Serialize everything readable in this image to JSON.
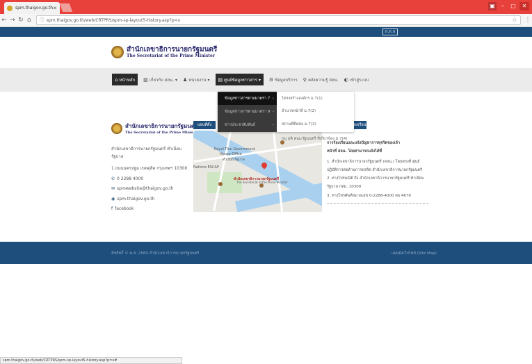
{
  "browser": {
    "tab_title": "spm.thaigov.go.th",
    "url": "spm.thaigov.go.th/web/CRTPRS/spm-sp-layout5-history.asp?p=x",
    "status_url": "spm.thaigov.go.th/web/CRTPRS/spm-sp-layout5-history.asp?p=x#"
  },
  "topstrip": {
    "badge": "ก.ก.ก"
  },
  "logo": {
    "thai": "สำนักเลขาธิการนายกรัฐมนตรี",
    "english": "The Secretariat of the Prime Minister"
  },
  "menu": [
    {
      "icon": "⌂",
      "label": "หน้าหลัก"
    },
    {
      "icon": "▥",
      "label": "เกี่ยวกับ สลน. ▾"
    },
    {
      "icon": "♟",
      "label": "หน่วยงาน ▾"
    },
    {
      "icon": "▤",
      "label": "ศูนย์ข้อมูลข่าวสาร ▾"
    },
    {
      "icon": "⚙",
      "label": "ข้อมูลบริการ"
    },
    {
      "icon": "♀",
      "label": "คลังความรู้ สลน."
    },
    {
      "icon": "◐",
      "label": "เข้าสู่ระบบ"
    }
  ],
  "dropdown": {
    "left": [
      {
        "label": "ข้อมูลข่าวสารตามมาตรา 7",
        "arrow": "›"
      },
      {
        "label": "ข้อมูลข่าวสารตามมาตรา 9",
        "arrow": "›"
      },
      {
        "label": "ข่าวประชาสัมพันธ์",
        "arrow": "›"
      }
    ],
    "right": [
      "โครงสร้างองค์กร ม.7(1)",
      "อำนาจหน้าที่ ม.7(2)",
      "สถานที่ติดต่อ ม.7(3)",
      "กฎ มติ คณะรัฐมนตรี ที่เกี่ยวข้อง ม.7(4)"
    ]
  },
  "contact": {
    "line1": "สำนักเลขาธิการนายกรัฐมนตรี ทำเนียบ",
    "line2": "รัฐบาล",
    "line3": "1 ถนนนครปฐม เขตดุสิต กรุงเทพฯ 10300",
    "phone": "0 2288 4000",
    "email": "spmwebsite@thaigov.go.th",
    "web": "spm.thaigov.go.th",
    "facebook": "facebook"
  },
  "map": {
    "heading": "แผนที่ตั้ง",
    "labels": [
      "Royal Thai Government",
      "House Office",
      "ทำเนียบรัฐบาล",
      "Nations ESCAP",
      "สำนักเลขาธิการนายกรัฐมนตรี",
      "The Secretariat of the Prime Minister"
    ]
  },
  "info": {
    "heading": "ร้องเรียน",
    "lines": [
      "การร้องเรียนและแจ้งปัญหาการทุจริตของเจ้า",
      "หน้าที่ สลน. โดยสามารถแจ้งได้ที่",
      "1. สำนักเลขาธิการนายกรัฐมนตรี (สลน.) โดยตรงที่ ศูนย์",
      "ปฏิบัติการต่อต้านการทุจริต สำนักเลขาธิการนายกรัฐมนตรี",
      "2. ทางไปรษณีย์ ถึง สำนักเลขาธิการนายกรัฐมนตรี ทำเนียบ",
      "รัฐบาล กทม. 10300",
      "3. ทางโทรศัพท์หมายเลข 0-2288-4000 ต่อ 4676"
    ]
  },
  "footer": {
    "copyright": "ลิขสิทธิ์ © พ.ศ. 2560 สำนักเลขาธิการนายกรัฐมนตรี",
    "sitemap": "แผนผังเว็บไซต์ (Site Map)"
  },
  "colors": {
    "brand": "#1e4e7c",
    "chrome": "#e8403a"
  }
}
